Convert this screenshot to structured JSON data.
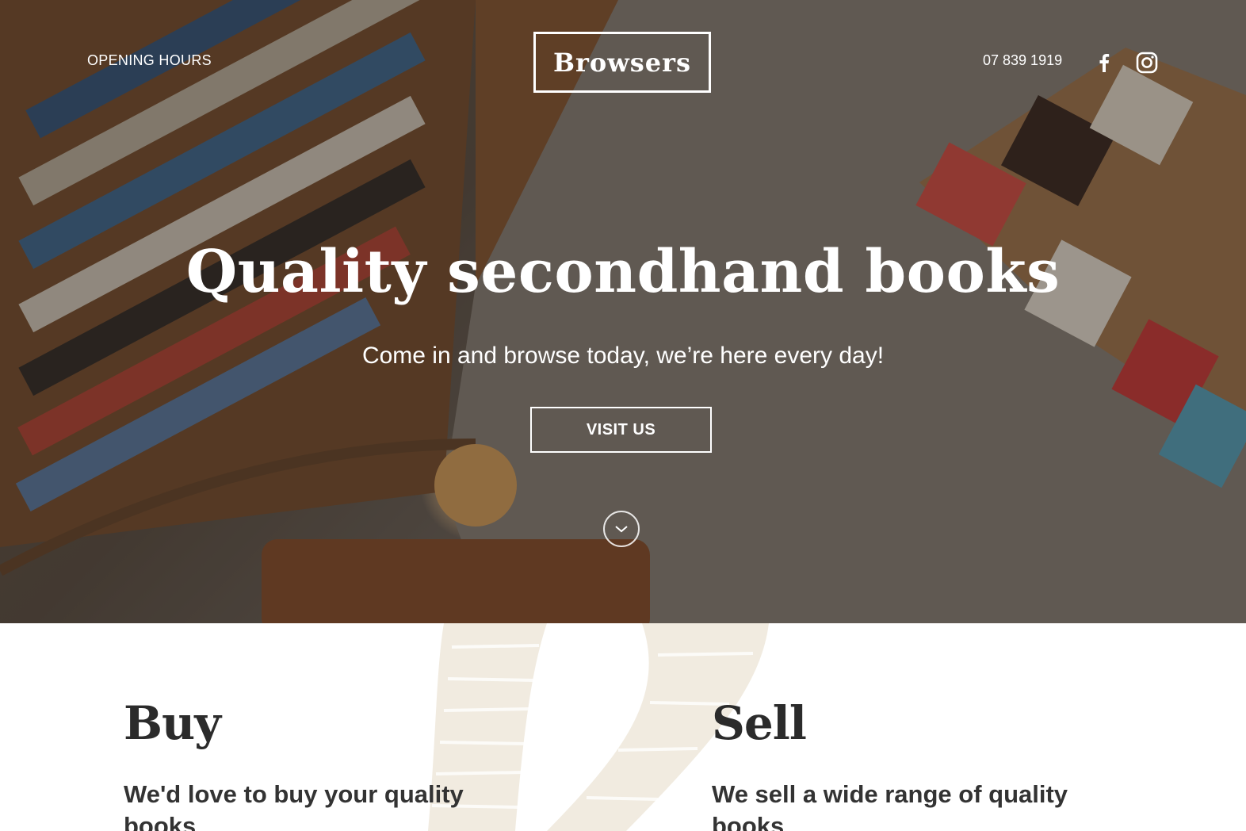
{
  "header": {
    "nav_opening_hours": "OPENING HOURS",
    "logo_text": "Browsers",
    "phone": "07 839 1919",
    "social": [
      "facebook-icon",
      "instagram-icon"
    ]
  },
  "hero": {
    "headline": "Quality secondhand books",
    "subheadline": "Come in and browse today, we’re here every day!",
    "cta_label": "VISIT US",
    "scroll_icon": "chevron-down-icon"
  },
  "services": {
    "buy": {
      "title": "Buy",
      "text": "We'd love to buy your quality books"
    },
    "sell": {
      "title": "Sell",
      "text": "We sell a wide range of quality books"
    }
  },
  "colors": {
    "text_dark": "#2b2b2b",
    "watermark": "#f1ebe0",
    "hero_text": "#ffffff"
  }
}
